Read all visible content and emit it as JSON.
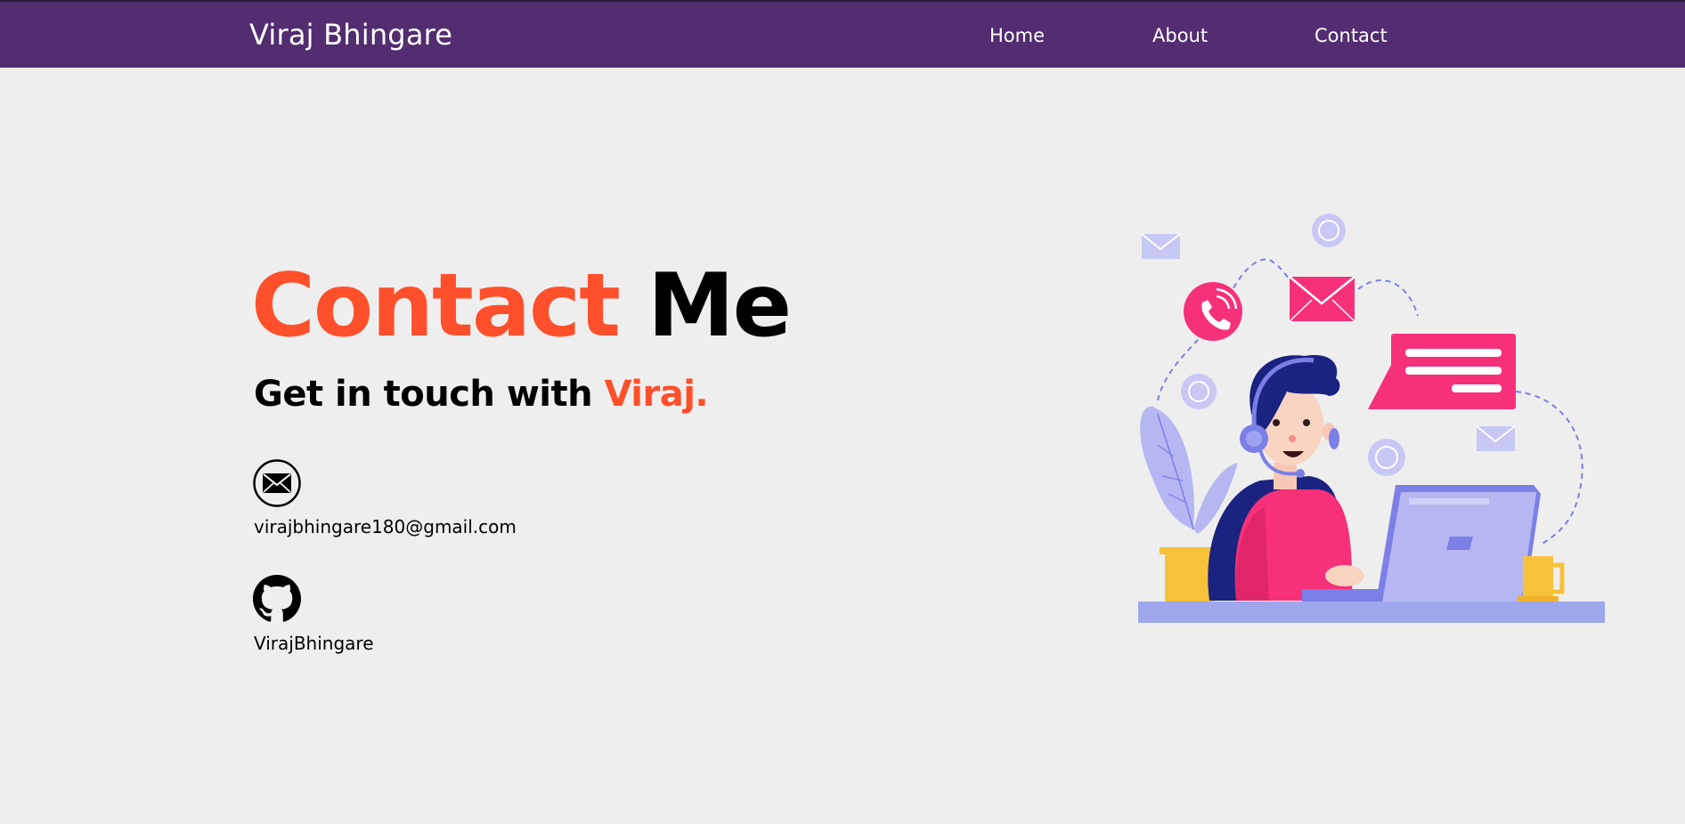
{
  "navbar": {
    "brand": "Viraj Bhingare",
    "links": [
      {
        "label": "Home"
      },
      {
        "label": "About"
      },
      {
        "label": "Contact"
      }
    ],
    "background": "#522d6f"
  },
  "hero": {
    "title_part1": "Contact",
    "title_part2": "Me",
    "subtitle_part1": "Get in touch with",
    "subtitle_part2": "Viraj.",
    "accent_color": "#ff4f2b"
  },
  "contacts": [
    {
      "icon": "envelope-icon",
      "text": "virajbhingare180@gmail.com"
    },
    {
      "icon": "github-icon",
      "text": "VirajBhingare"
    }
  ],
  "illustration": {
    "icon": "customer-support-illustration"
  }
}
